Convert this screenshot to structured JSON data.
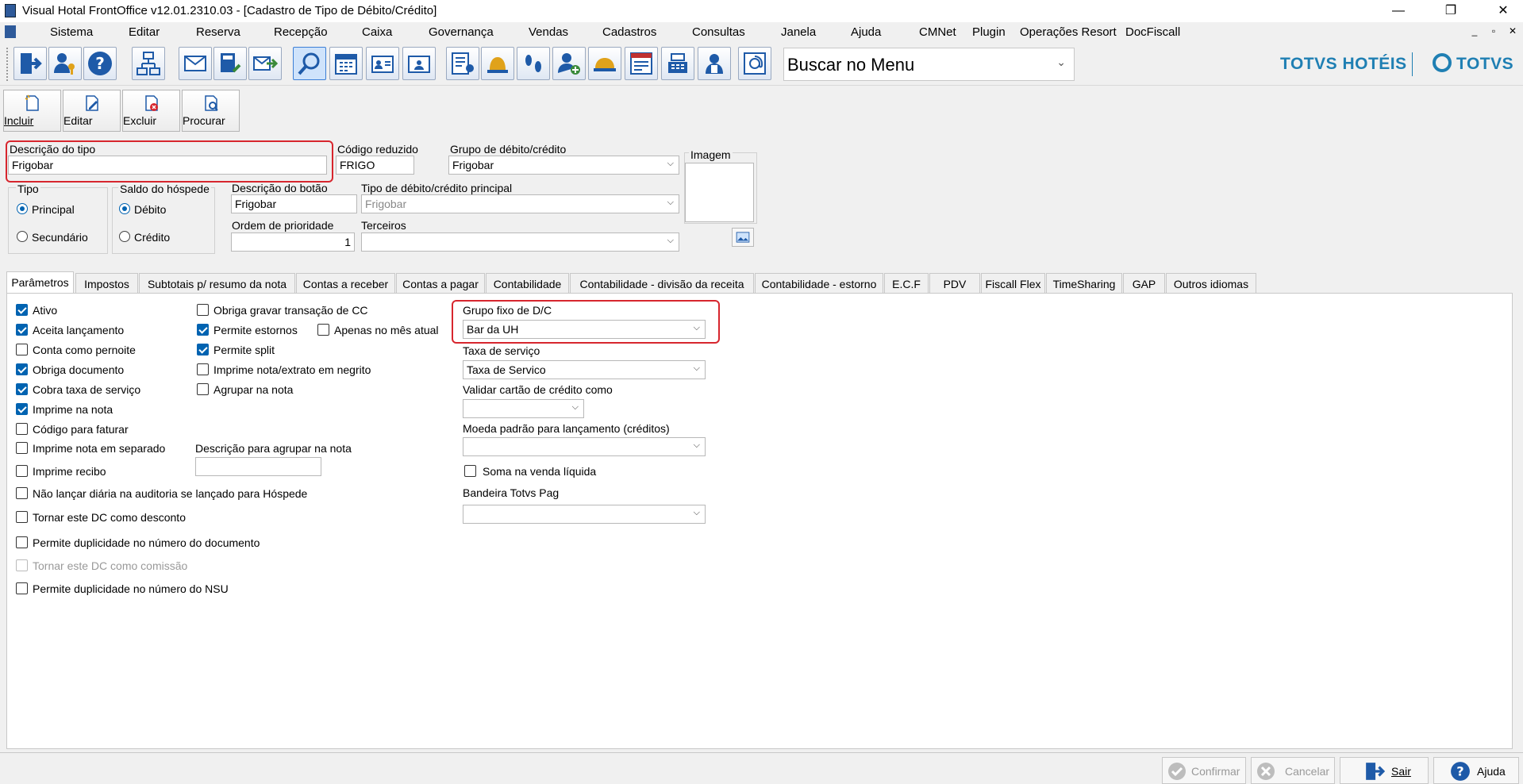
{
  "window": {
    "title": "Visual Hotal FrontOffice v12.01.2310.03 - [Cadastro de Tipo de Débito/Crédito]",
    "minimize_icon": "minimize-icon",
    "restore_icon": "restore-icon",
    "close_icon": "close-icon"
  },
  "menu": {
    "items": [
      "Sistema",
      "Editar",
      "Reserva",
      "Recepção",
      "Caixa",
      "Governança",
      "Vendas",
      "Cadastros",
      "Consultas",
      "Janela",
      "Ajuda",
      "CMNet",
      "Plugin",
      "Operações Resort",
      "DocFiscall"
    ],
    "mdi_controls": [
      "_",
      "▫",
      "✕"
    ]
  },
  "toolbar": {
    "search_text": "Buscar no Menu",
    "brand_left": "TOTVS HOTÉIS",
    "brand_right": "TOTVS",
    "icons": [
      "logout-icon",
      "user-key-icon",
      "help-icon",
      "org-chart-icon",
      "mail-icon",
      "calculator-icon",
      "send-mail-icon",
      "search-icon",
      "calendar-icon",
      "guest-card-icon",
      "id-card-icon",
      "rooms-list-icon",
      "bell-icon",
      "footprints-icon",
      "add-guest-icon",
      "service-bell-icon",
      "invoice-icon",
      "cash-register-icon",
      "maid-icon",
      "email-at-icon"
    ]
  },
  "actions": {
    "incluir": "Incluir",
    "editar": "Editar",
    "excluir": "Excluir",
    "procurar": "Procurar"
  },
  "form": {
    "descricao_tipo_label": "Descrição do tipo",
    "descricao_tipo_value": "Frigobar",
    "codigo_reduzido_label": "Código reduzido",
    "codigo_reduzido_value": "FRIGO",
    "grupo_label": "Grupo de débito/crédito",
    "grupo_value": "Frigobar",
    "imagem_label": "Imagem",
    "tipo_label": "Tipo",
    "tipo_principal": "Principal",
    "tipo_secundario": "Secundário",
    "saldo_label": "Saldo do hóspede",
    "saldo_debito": "Débito",
    "saldo_credito": "Crédito",
    "descricao_botao_label": "Descrição do botão",
    "descricao_botao_value": "Frigobar",
    "tipo_principal_label": "Tipo de débito/crédito principal",
    "tipo_principal_value": "Frigobar",
    "ordem_label": "Ordem de prioridade",
    "ordem_value": "1",
    "terceiros_label": "Terceiros",
    "terceiros_value": ""
  },
  "tabs": [
    "Parâmetros",
    "Impostos",
    "Subtotais p/ resumo da nota",
    "Contas a receber",
    "Contas a pagar",
    "Contabilidade",
    "Contabilidade - divisão da receita",
    "Contabilidade - estorno",
    "E.C.F",
    "PDV",
    "Fiscall Flex",
    "TimeSharing",
    "GAP",
    "Outros idiomas"
  ],
  "params": {
    "col1": [
      {
        "label": "Ativo",
        "checked": true
      },
      {
        "label": "Aceita lançamento",
        "checked": true
      },
      {
        "label": "Conta como pernoite",
        "checked": false
      },
      {
        "label": "Obriga documento",
        "checked": true
      },
      {
        "label": "Cobra taxa de serviço",
        "checked": true
      },
      {
        "label": "Imprime na nota",
        "checked": true
      },
      {
        "label": "Código para faturar",
        "checked": false
      },
      {
        "label": "Imprime nota em separado",
        "checked": false
      },
      {
        "label": "Imprime recibo",
        "checked": false
      },
      {
        "label": "Não lançar diária na auditoria se lançado para Hóspede",
        "checked": false
      },
      {
        "label": "Tornar este DC como desconto",
        "checked": false
      },
      {
        "label": "Permite duplicidade no número do documento",
        "checked": false
      },
      {
        "label": "Tornar este DC como comissão",
        "checked": false
      },
      {
        "label": "Permite duplicidade no número do NSU",
        "checked": false
      }
    ],
    "col2": [
      {
        "label": "Obriga gravar transação de CC",
        "checked": false
      },
      {
        "label": "Permite estornos",
        "checked": true
      },
      {
        "label": "Permite split",
        "checked": true
      },
      {
        "label": "Imprime nota/extrato em negrito",
        "checked": false
      },
      {
        "label": "Agrupar na nota",
        "checked": false
      }
    ],
    "apenas_mes_atual": "Apenas no mês atual",
    "descricao_agrupar_label": "Descrição para agrupar na nota",
    "descricao_agrupar_value": "",
    "grupo_fixo_label": "Grupo fixo de D/C",
    "grupo_fixo_value": "Bar da UH",
    "taxa_servico_label": "Taxa de serviço",
    "taxa_servico_value": "Taxa de Servico",
    "validar_cartao_label": "Validar cartão de crédito como",
    "validar_cartao_value": "",
    "moeda_label": "Moeda padrão para lançamento (créditos)",
    "moeda_value": "",
    "soma_venda_label": "Soma na venda líquida",
    "bandeira_label": "Bandeira Totvs Pag",
    "bandeira_value": ""
  },
  "footer": {
    "confirmar": "Confirmar",
    "cancelar": "Cancelar",
    "sair": "Sair",
    "ajuda": "Ajuda"
  },
  "colors": {
    "accent": "#0063b1",
    "highlight": "#d7262e",
    "brand": "#1f7fb3"
  }
}
